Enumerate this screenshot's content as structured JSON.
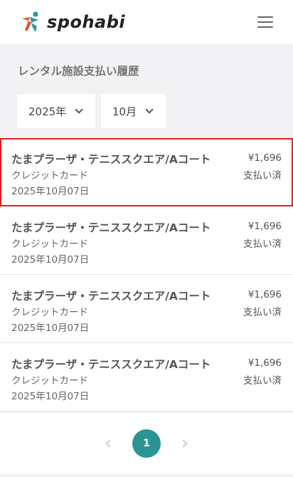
{
  "header": {
    "brand": "spohabi",
    "menu_icon": "hamburger-menu-icon",
    "logo_colors": [
      "#2a9d98",
      "#e8502a",
      "#2a9d98"
    ]
  },
  "page": {
    "title": "レンタル施設支払い履歴"
  },
  "filters": {
    "year": "2025年",
    "month": "10月"
  },
  "payments": [
    {
      "facility": "たまプラーザ・テニススクエア/Aコート",
      "method": "クレジットカード",
      "date": "2025年10月07日",
      "amount": "¥1,696",
      "status": "支払い済"
    },
    {
      "facility": "たまプラーザ・テニススクエア/Aコート",
      "method": "クレジットカード",
      "date": "2025年10月07日",
      "amount": "¥1,696",
      "status": "支払い済"
    },
    {
      "facility": "たまプラーザ・テニススクエア/Aコート",
      "method": "クレジットカード",
      "date": "2025年10月07日",
      "amount": "¥1,696",
      "status": "支払い済"
    },
    {
      "facility": "たまプラーザ・テニススクエア/Aコート",
      "method": "クレジットカード",
      "date": "2025年10月07日",
      "amount": "¥1,696",
      "status": "支払い済"
    }
  ],
  "pagination": {
    "current": "1",
    "accent": "#2a9494"
  }
}
